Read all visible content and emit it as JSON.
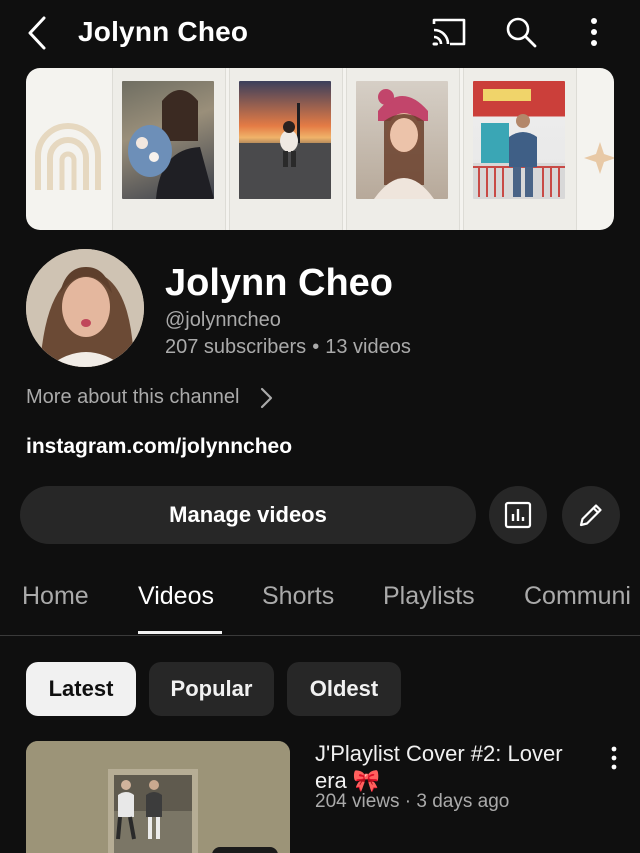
{
  "topbar": {
    "title": "Jolynn Cheo",
    "icons": [
      "back-arrow-icon",
      "cast-icon",
      "search-icon",
      "more-vertical-icon"
    ]
  },
  "channel": {
    "name": "Jolynn Cheo",
    "handle": "@jolynncheo",
    "subscribers": "207 subscribers",
    "separator": "•",
    "videos": "13 videos",
    "more_about": "More about this channel",
    "link": "instagram.com/jolynncheo"
  },
  "actions": {
    "manage_label": "Manage videos",
    "analytics_icon": "analytics-icon",
    "edit_icon": "pencil-icon"
  },
  "tabs": [
    {
      "label": "Home",
      "active": false
    },
    {
      "label": "Videos",
      "active": true
    },
    {
      "label": "Shorts",
      "active": false
    },
    {
      "label": "Playlists",
      "active": false
    },
    {
      "label": "Communi",
      "active": false
    }
  ],
  "filters": [
    {
      "label": "Latest",
      "active": true
    },
    {
      "label": "Popular",
      "active": false
    },
    {
      "label": "Oldest",
      "active": false
    }
  ],
  "video": {
    "title": "J'Playlist Cover #2: Lover era 🎀",
    "meta": "204 views · 3 days ago"
  },
  "colors": {
    "background": "#0f0f0f",
    "surface": "#272727",
    "text_primary": "#f1f1f1",
    "text_secondary": "#aaaaaa",
    "banner_bg": "#f4f3ef"
  }
}
